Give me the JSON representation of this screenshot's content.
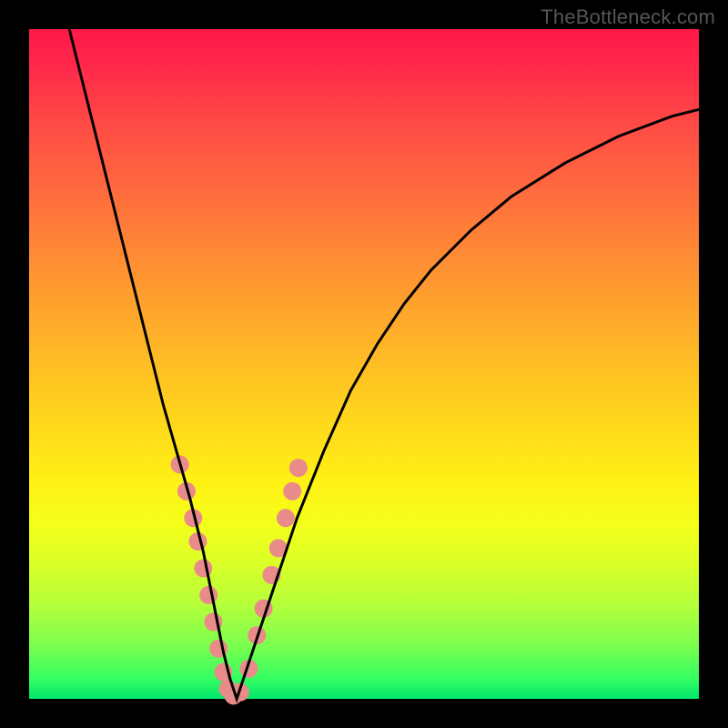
{
  "watermark": "TheBottleneck.com",
  "chart_data": {
    "type": "line",
    "title": "",
    "xlabel": "",
    "ylabel": "",
    "xlim": [
      0,
      100
    ],
    "ylim": [
      0,
      100
    ],
    "series": [
      {
        "name": "bottleneck-curve",
        "x": [
          6,
          8,
          10,
          12,
          14,
          16,
          18,
          20,
          22,
          24,
          26,
          27,
          28,
          29,
          30,
          31,
          32,
          34,
          36,
          38,
          40,
          44,
          48,
          52,
          56,
          60,
          66,
          72,
          80,
          88,
          96,
          100
        ],
        "values": [
          100,
          92,
          84,
          76,
          68,
          60,
          52,
          44,
          37,
          30,
          22,
          17,
          12,
          7,
          3,
          0,
          3,
          9,
          15,
          21,
          27,
          37,
          46,
          53,
          59,
          64,
          70,
          75,
          80,
          84,
          87,
          88
        ]
      }
    ],
    "markers": {
      "name": "highlight-points",
      "x": [
        22.5,
        23.5,
        24.5,
        25.2,
        26.0,
        26.8,
        27.5,
        28.3,
        29.0,
        29.7,
        30.5,
        31.5,
        32.8,
        34.0,
        35.0,
        36.2,
        37.2,
        38.3,
        39.3,
        40.2
      ],
      "values": [
        35.0,
        31.0,
        27.0,
        23.5,
        19.5,
        15.5,
        11.5,
        7.5,
        4.0,
        1.5,
        0.5,
        1.0,
        4.5,
        9.5,
        13.5,
        18.5,
        22.5,
        27.0,
        31.0,
        34.5
      ],
      "color": "#e98b88",
      "radius": 10
    },
    "curve_color": "#000000",
    "curve_width": 3
  }
}
